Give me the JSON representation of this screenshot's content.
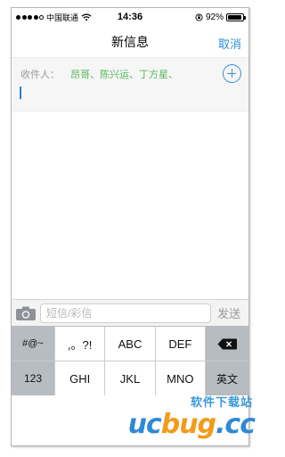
{
  "status_bar": {
    "signal_bars": 4,
    "carrier": "中国联通",
    "time": "14:36",
    "battery_text": "92%",
    "battery_level": 0.92
  },
  "nav": {
    "title": "新信息",
    "cancel_label": "取消"
  },
  "recipients": {
    "label": "收件人：",
    "names": "昂哥、陈兴运、丁方星、"
  },
  "compose": {
    "placeholder": "短信/彩信",
    "value": "",
    "send_label": "发送"
  },
  "keyboard": {
    "row1": [
      "#@~",
      ",。?!",
      "ABC",
      "DEF"
    ],
    "row2": [
      "123",
      "GHI",
      "JKL",
      "MNO",
      "英文"
    ]
  },
  "watermark": {
    "cn": "软件下载站",
    "brand_a": "uc",
    "brand_b": "bug",
    "brand_c": ".cc"
  },
  "colors": {
    "accent_blue": "#2f8fd8",
    "recipient_green": "#55b85a",
    "key_function_gray": "#b7bcc1"
  },
  "icons": [
    "wifi-icon",
    "orientation-lock-icon",
    "battery-icon",
    "add-contact-icon",
    "camera-icon",
    "delete-icon"
  ]
}
